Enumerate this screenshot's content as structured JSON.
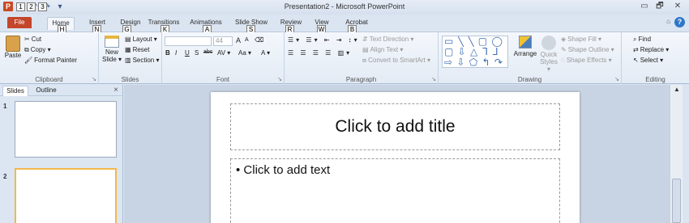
{
  "window": {
    "title": "Presentation2 - Microsoft PowerPoint",
    "app_icon": "P",
    "controls": {
      "minimize": "▭",
      "restore": "🗗",
      "close": "✕"
    }
  },
  "qat": {
    "keytips": [
      "1",
      "2",
      "3"
    ],
    "customize": "▾"
  },
  "tabs": {
    "file": "File",
    "items": [
      "Home",
      "Insert",
      "Design",
      "Transitions",
      "Animations",
      "Slide Show",
      "Review",
      "View",
      "Acrobat"
    ],
    "keytips": [
      "F",
      "H",
      "N",
      "G",
      "K",
      "A",
      "S",
      "R",
      "W",
      "B"
    ],
    "help": "?",
    "minimize_ribbon": "⌂"
  },
  "ribbon": {
    "clipboard": {
      "label": "Clipboard",
      "paste": "Paste",
      "cut": "Cut",
      "copy": "Copy ▾",
      "format_painter": "Format Painter"
    },
    "slides": {
      "label": "Slides",
      "new_slide": "New",
      "new_slide2": "Slide ▾",
      "layout": "Layout ▾",
      "reset": "Reset",
      "section": "Section ▾"
    },
    "font": {
      "label": "Font",
      "font_size": "44",
      "grow": "A",
      "shrink": "A",
      "bold": "B",
      "italic": "I",
      "underline": "U",
      "shadow": "S",
      "strike": "abc",
      "spacing": "AV ▾",
      "case": "Aa ▾",
      "color": "A ▾"
    },
    "paragraph": {
      "label": "Paragraph",
      "text_direction": "Text Direction ▾",
      "align_text": "Align Text ▾",
      "convert_smartart": "Convert to SmartArt ▾"
    },
    "drawing": {
      "label": "Drawing",
      "arrange": "Arrange",
      "quick_styles": "Quick",
      "quick_styles2": "Styles ▾",
      "shape_fill": "Shape Fill ▾",
      "shape_outline": "Shape Outline ▾",
      "shape_effects": "Shape Effects ▾",
      "shapes_glyphs": "▭ ╲ ╲ ▢ ◯ ▢ ⇩ △ ᒣ ᒧ ⇨ ⇩ ⬠ ↰ ↷ ⌒ { } ☆"
    },
    "editing": {
      "label": "Editing",
      "find": "Find",
      "replace": "Replace ▾",
      "select": "Select ▾"
    }
  },
  "panel": {
    "tabs": [
      "Slides",
      "Outline"
    ],
    "close": "×",
    "slides": [
      "1",
      "2"
    ]
  },
  "slide": {
    "title_placeholder": "Click to add title",
    "body_placeholder": "• Click to add text"
  },
  "scrollbar": {
    "up": "▲"
  }
}
